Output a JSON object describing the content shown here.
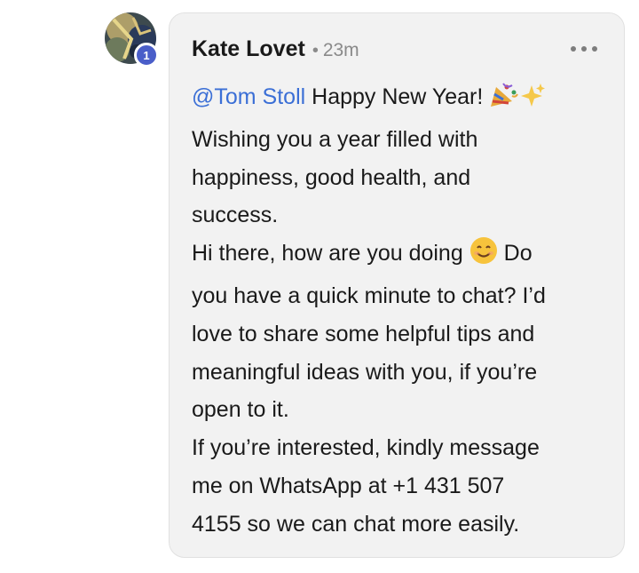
{
  "comment": {
    "author": "Kate Lovet",
    "separator": "•",
    "timestamp": "23m",
    "avatar_badge": "1",
    "mention": "@Tom Stoll",
    "message_lines": [
      " Happy New Year!",
      "Wishing you a year filled with",
      "happiness, good health, and",
      "success.",
      "Hi there, how are you doing",
      " Do",
      "you have a quick minute to chat? I’d",
      "love to share some helpful tips and",
      "meaningful ideas with you, if you’re",
      "open to it.",
      "If you’re interested, kindly message",
      "me on WhatsApp at +1 431 507",
      "4155 so we can chat more easily."
    ]
  },
  "icons": {
    "party": "party-popper-emoji",
    "sparkles": "sparkles-emoji",
    "smile": "smiling-face-emoji",
    "more": "more-options-icon"
  },
  "colors": {
    "mention": "#3b6fd6",
    "badge": "#4a5ec9",
    "card_background": "#f2f2f2",
    "muted_text": "#8a8a8a"
  }
}
